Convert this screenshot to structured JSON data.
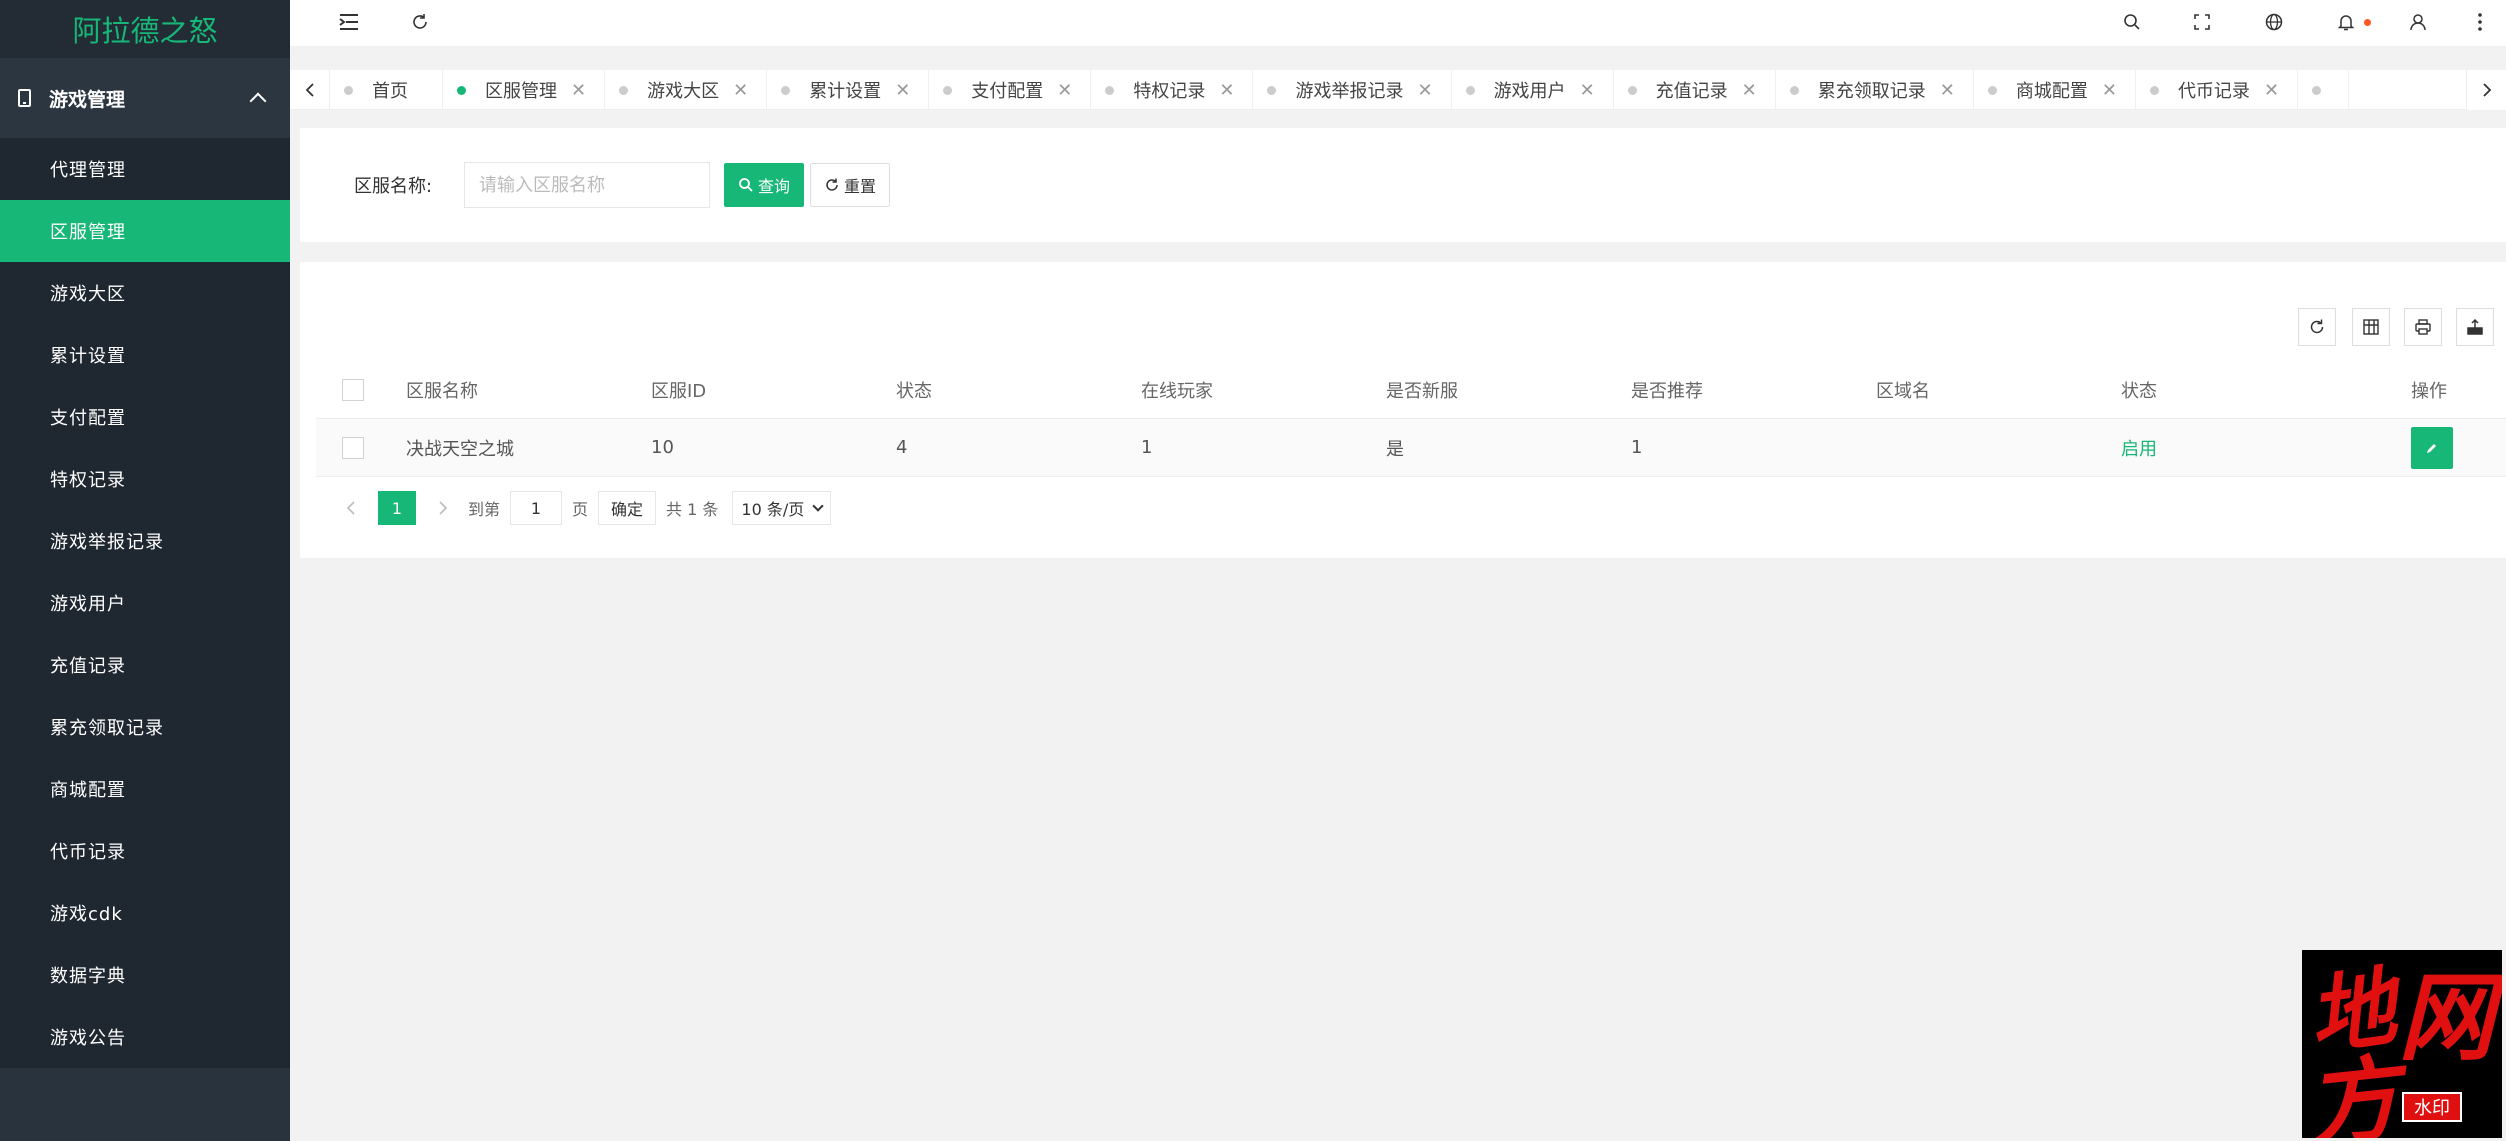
{
  "app": {
    "title": "阿拉德之怒"
  },
  "sidebar": {
    "group_label": "游戏管理",
    "items": [
      {
        "label": "代理管理",
        "active": false
      },
      {
        "label": "区服管理",
        "active": true
      },
      {
        "label": "游戏大区",
        "active": false
      },
      {
        "label": "累计设置",
        "active": false
      },
      {
        "label": "支付配置",
        "active": false
      },
      {
        "label": "特权记录",
        "active": false
      },
      {
        "label": "游戏举报记录",
        "active": false
      },
      {
        "label": "游戏用户",
        "active": false
      },
      {
        "label": "充值记录",
        "active": false
      },
      {
        "label": "累充领取记录",
        "active": false
      },
      {
        "label": "商城配置",
        "active": false
      },
      {
        "label": "代币记录",
        "active": false
      },
      {
        "label": "游戏cdk",
        "active": false
      },
      {
        "label": "数据字典",
        "active": false
      },
      {
        "label": "游戏公告",
        "active": false
      }
    ]
  },
  "header": {
    "icons": [
      "menu-fold-icon",
      "refresh-icon",
      "search-icon",
      "fullscreen-icon",
      "globe-icon",
      "bell-icon",
      "user-icon",
      "more-icon"
    ]
  },
  "tabs": [
    {
      "label": "首页",
      "active": false,
      "closable": false
    },
    {
      "label": "区服管理",
      "active": true,
      "closable": true
    },
    {
      "label": "游戏大区",
      "active": false,
      "closable": true
    },
    {
      "label": "累计设置",
      "active": false,
      "closable": true
    },
    {
      "label": "支付配置",
      "active": false,
      "closable": true
    },
    {
      "label": "特权记录",
      "active": false,
      "closable": true
    },
    {
      "label": "游戏举报记录",
      "active": false,
      "closable": true
    },
    {
      "label": "游戏用户",
      "active": false,
      "closable": true
    },
    {
      "label": "充值记录",
      "active": false,
      "closable": true
    },
    {
      "label": "累充领取记录",
      "active": false,
      "closable": true
    },
    {
      "label": "商城配置",
      "active": false,
      "closable": true
    },
    {
      "label": "代币记录",
      "active": false,
      "closable": true
    }
  ],
  "search": {
    "label": "区服名称:",
    "placeholder": "请输入区服名称",
    "value": "",
    "query_label": "查询",
    "reset_label": "重置"
  },
  "table": {
    "columns": [
      "区服名称",
      "区服ID",
      "状态",
      "在线玩家",
      "是否新服",
      "是否推荐",
      "区域名",
      "状态",
      "操作"
    ],
    "rows": [
      {
        "name": "决战天空之城",
        "id": "10",
        "state": "4",
        "online": "1",
        "is_new": "是",
        "recommend": "1",
        "region": "",
        "status": "启用"
      }
    ]
  },
  "pagination": {
    "current": "1",
    "goto_label": "到第",
    "goto_value": "1",
    "page_unit": "页",
    "confirm_label": "确定",
    "total_label": "共 1 条",
    "page_size": "10 条/页"
  },
  "watermark": {
    "chars": [
      "地",
      "网",
      "方"
    ],
    "badge": "水印"
  },
  "colors": {
    "accent": "#16b777",
    "sidebar_bg": "#28333e",
    "notify_dot": "#ff5722"
  }
}
